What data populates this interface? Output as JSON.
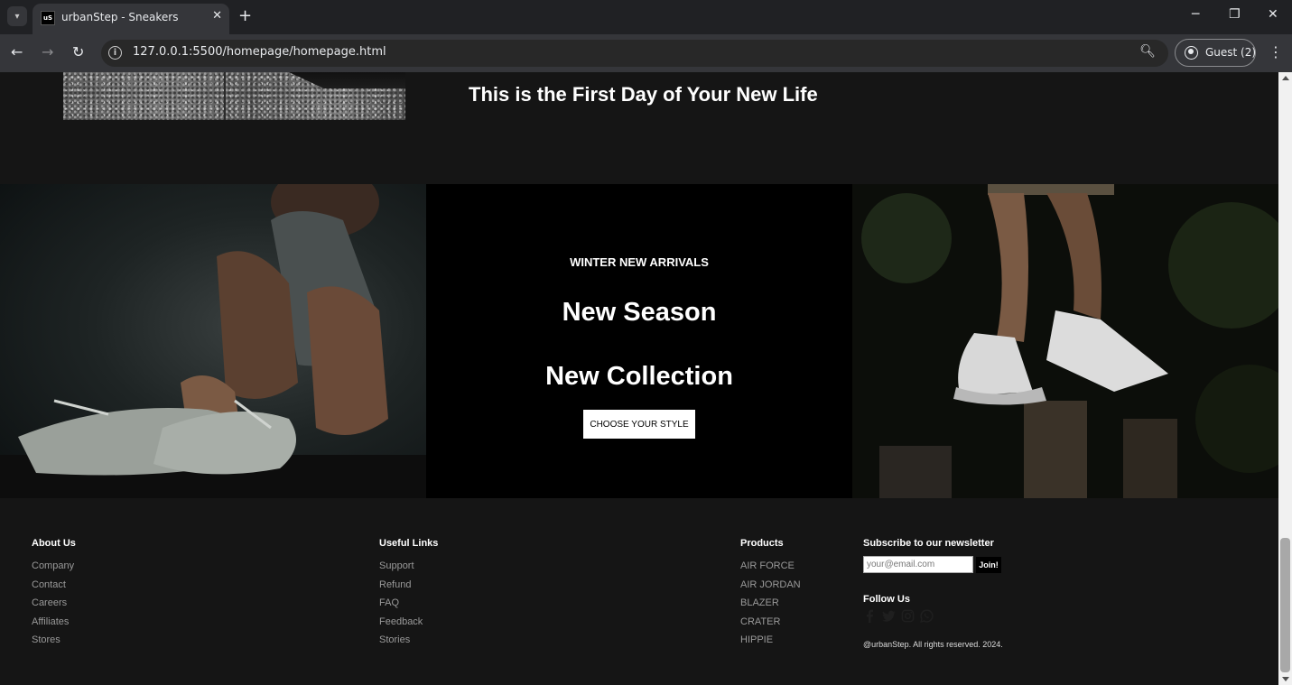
{
  "browser": {
    "tab_title": "urbanStep - Sneakers",
    "favicon_text": "uS",
    "url": "127.0.0.1:5500/homepage/homepage.html",
    "profile_label": "Guest (2)"
  },
  "hero": {
    "heading": "This is the First Day of Your New Life"
  },
  "collection": {
    "eyebrow": "WINTER NEW ARRIVALS",
    "title_line1": "New Season",
    "title_line2": "New Collection",
    "cta_label": "CHOOSE YOUR STYLE"
  },
  "footer": {
    "about": {
      "title": "About Us",
      "links": [
        "Company",
        "Contact",
        "Careers",
        "Affiliates",
        "Stores"
      ]
    },
    "useful": {
      "title": "Useful Links",
      "links": [
        "Support",
        "Refund",
        "FAQ",
        "Feedback",
        "Stories"
      ]
    },
    "products": {
      "title": "Products",
      "links": [
        "AIR FORCE",
        "AIR JORDAN",
        "BLAZER",
        "CRATER",
        "HIPPIE"
      ]
    },
    "newsletter": {
      "title": "Subscribe to our newsletter",
      "placeholder": "your@email.com",
      "join_label": "Join!",
      "follow_title": "Follow Us",
      "social_icons": [
        "facebook-icon",
        "twitter-icon",
        "instagram-icon",
        "whatsapp-icon"
      ],
      "copyright": "@urbanStep. All rights reserved. 2024."
    }
  }
}
